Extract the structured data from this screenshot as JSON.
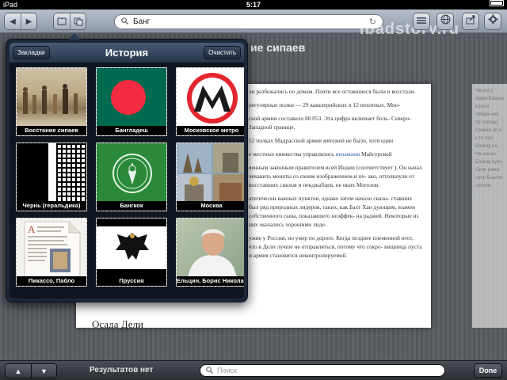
{
  "status_bar": {
    "device": "iPad",
    "time": "5:17"
  },
  "toolbar": {
    "search_query": "Банг",
    "watermark": "ipadstory.ru"
  },
  "article": {
    "heading": "ие сипаев",
    "paragraphs": [
      "ли разбежались по домам. Почти все оставшиеся были и восстали.",
      "регулярные полки — 29 кавалерийских и 12 пехотных. Мно-",
      "ской армии составило 80 053. Эта цифра включает боль- Северо-Западной границе.",
      "52 полках Мадрасской армии мятежей не было, хотя один",
      "е местные княжества управлялись",
      "венным законным правителем всей Индии (соответствует ). Он начал чеканить монеты со своим изображением и по- ако, оттолкнули от восставших сикхов и пенджабцев, не иких Моголов.",
      "атегически важных пунктов, однако затем начало сказы- ставших был ряд природных лидеров, таких, как Бахт Хан дующим, взамен собственного сына, показавшего неэффек- на раджей. Некоторые из них оказались хорошими лиде-",
      "ужие у России, но умер по дороге. Когда позднее племенной итет, что в Дели лучше не отправляться, потому что сокро- вищница пуста и армия становится неконтролируемой."
    ],
    "link_word": "низамами",
    "link_suffix": " Майсурской",
    "subheading": "Осада Дели",
    "side_text": "Число у Адми Благов в реги губерн ких пр послед Списки ab в к те пол Благод на На начал Благов сухо- Сепо режо-сопр Благов постоя"
  },
  "history_popover": {
    "title": "История",
    "bookmarks_label": "Закладки",
    "clear_label": "Очистить",
    "items": [
      {
        "caption": "Восстание сипаев"
      },
      {
        "caption": "Бангладеш"
      },
      {
        "caption": "Московское метро"
      },
      {
        "caption": "Чернь (геральдика)"
      },
      {
        "caption": "Бангкок"
      },
      {
        "caption": "Москва"
      },
      {
        "caption": "Пикассо, Пабло"
      },
      {
        "caption": "Пруссия"
      },
      {
        "caption": "Ельцин, Борис Николае..."
      }
    ]
  },
  "bottom_bar": {
    "prev": "▲",
    "next": "▼",
    "results": "Результатов нет",
    "find_placeholder": "Поиск",
    "done": "Done"
  },
  "colors": {
    "bangladesh_green": "#006a4e",
    "bangladesh_red": "#f42a41",
    "metro_red": "#e3262e",
    "bangkok_green": "#2a8a3a"
  },
  "icons": [
    "back-icon",
    "forward-icon",
    "bookmarks-icon",
    "pages-icon",
    "search-icon",
    "reload-icon",
    "list-icon",
    "globe-icon",
    "share-icon",
    "settings-icon",
    "wifi-icon",
    "battery-icon"
  ]
}
